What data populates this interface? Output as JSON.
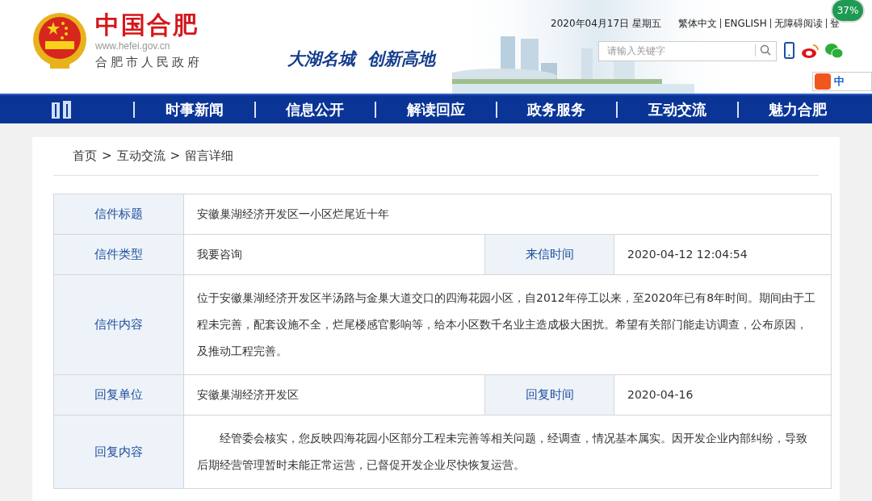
{
  "header": {
    "site_name": "中国合肥",
    "site_url": "www.hefei.gov.cn",
    "site_subtitle": "合肥市人民政府",
    "slogan": "大湖名城  创新高地",
    "date": "2020年04月17日 星期五",
    "top_links": [
      "繁体中文",
      "ENGLISH",
      "无障碍阅读",
      "登"
    ],
    "search": {
      "placeholder": "请输入关键字"
    },
    "badge": "37%",
    "ime": "中"
  },
  "nav": {
    "items": [
      "时事新闻",
      "信息公开",
      "解读回应",
      "政务服务",
      "互动交流",
      "魅力合肥"
    ]
  },
  "breadcrumb": {
    "separator": ">",
    "items": [
      "首页",
      "互动交流",
      "留言详细"
    ]
  },
  "rows": [
    {
      "cells": [
        {
          "label": "信件标题",
          "value": "安徽巢湖经济开发区一小区烂尾近十年"
        }
      ]
    },
    {
      "cells": [
        {
          "label": "信件类型",
          "value": "我要咨询"
        },
        {
          "label": "来信时间",
          "value": "2020-04-12 12:04:54"
        }
      ]
    },
    {
      "cells": [
        {
          "label": "信件内容",
          "value": "位于安徽巢湖经济开发区半汤路与金巢大道交口的四海花园小区，自2012年停工以来，至2020年已有8年时间。期间由于工程未完善，配套设施不全，烂尾楼感官影响等，给本小区数千名业主造成极大困扰。希望有关部门能走访调查，公布原因，及推动工程完善。"
        }
      ]
    },
    {
      "cells": [
        {
          "label": "回复单位",
          "value": "安徽巢湖经济开发区"
        },
        {
          "label": "回复时间",
          "value": "2020-04-16"
        }
      ]
    },
    {
      "cells": [
        {
          "label": "回复内容",
          "value": "经管委会核实，您反映四海花园小区部分工程未完善等相关问题，经调查，情况基本属实。因开发企业内部纠纷，导致后期经营管理暂时未能正常运营，已督促开发企业尽快恢复运营。",
          "indent": true
        }
      ]
    }
  ]
}
